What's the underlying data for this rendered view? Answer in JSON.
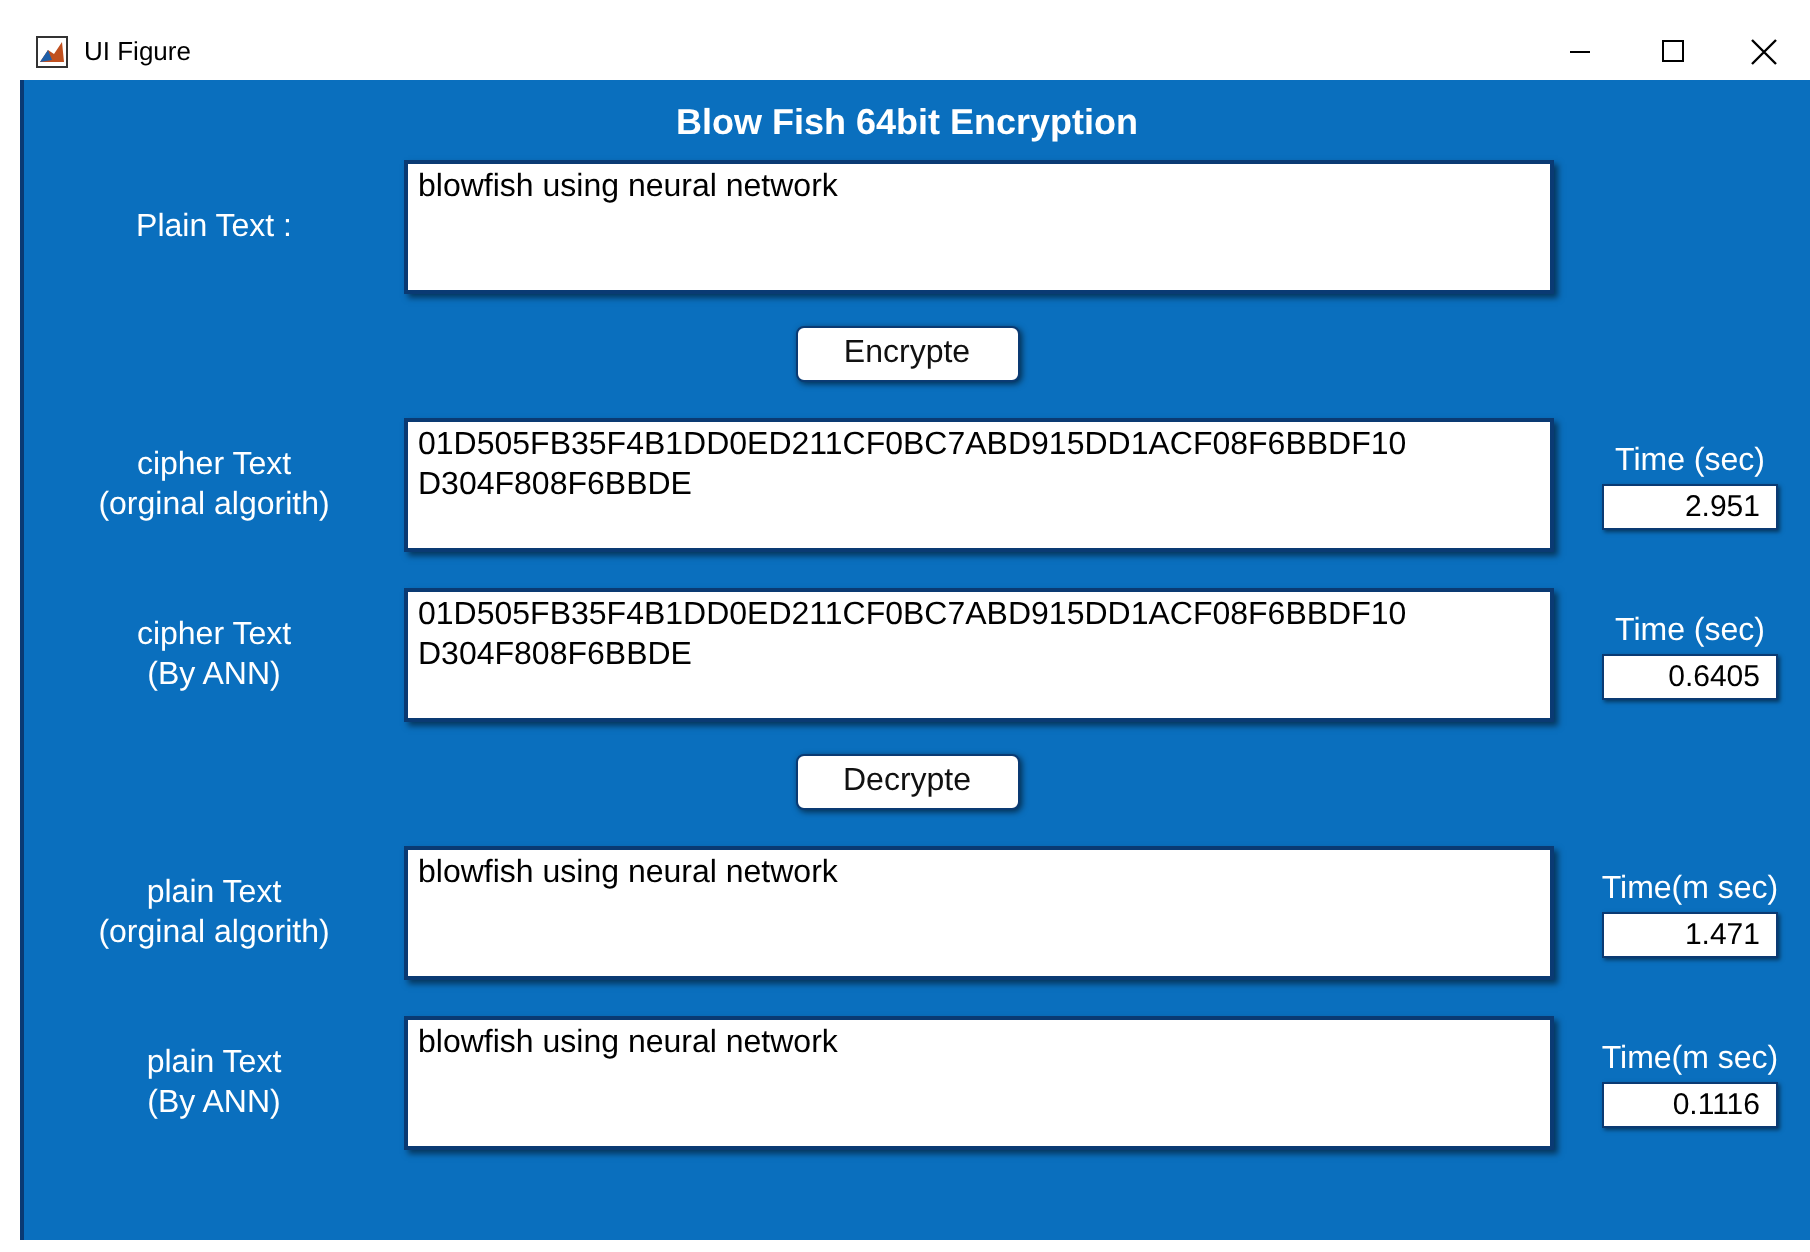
{
  "window": {
    "title": "UI Figure"
  },
  "heading": "Blow Fish 64bit Encryption",
  "items": [
    {
      "kind": "field",
      "label": [
        "Plain Text :"
      ],
      "text": [
        "blowfish using neural network"
      ]
    },
    {
      "kind": "button",
      "label": "Encrypte"
    },
    {
      "kind": "field",
      "label": [
        "cipher Text",
        "(orginal algorith)"
      ],
      "text": [
        "01D505FB35F4B1DD0ED211CF0BC7ABD915DD1ACF08F6BBDF10",
        "D304F808F6BBDE"
      ],
      "time_label": "Time (sec)",
      "time_value": "2.951"
    },
    {
      "kind": "field",
      "label": [
        "cipher Text",
        "(By ANN)"
      ],
      "text": [
        "01D505FB35F4B1DD0ED211CF0BC7ABD915DD1ACF08F6BBDF10",
        "D304F808F6BBDE"
      ],
      "time_label": "Time (sec)",
      "time_value": "0.6405"
    },
    {
      "kind": "button",
      "label": "Decrypte"
    },
    {
      "kind": "field",
      "label": [
        "plain Text",
        "(orginal algorith)"
      ],
      "text": [
        "blowfish using neural network"
      ],
      "time_label": "Time(m sec)",
      "time_value": "1.471"
    },
    {
      "kind": "field",
      "label": [
        "plain Text",
        "(By ANN)"
      ],
      "text": [
        "blowfish using neural network"
      ],
      "time_label": "Time(m sec)",
      "time_value": "0.1116"
    }
  ]
}
